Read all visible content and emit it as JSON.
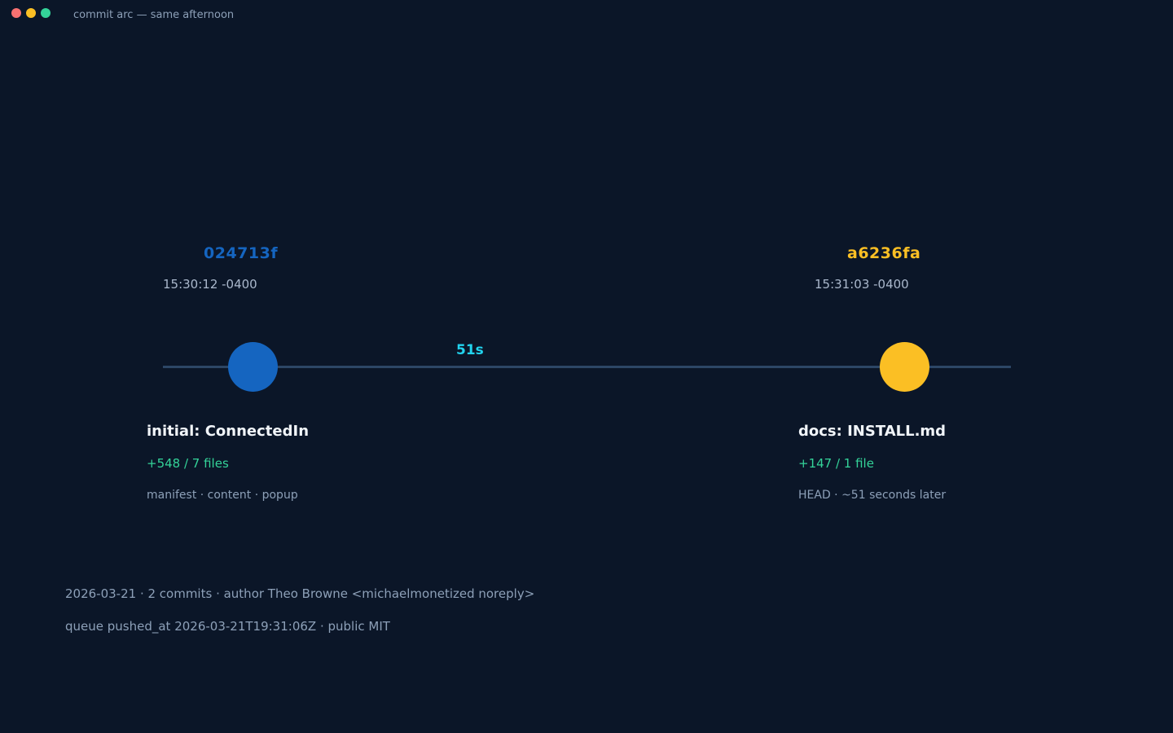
{
  "window": {
    "title": "commit arc — same afternoon",
    "controls": {
      "close_color": "#f87171",
      "minimize_color": "#fbbf24",
      "zoom_color": "#34d399"
    }
  },
  "colors": {
    "background": "#0b1628",
    "first_commit": "#1565c0",
    "second_commit": "#fbbf24",
    "delta": "#22d3ee",
    "additions": "#34d399",
    "timeline": "#2c4666"
  },
  "commits": [
    {
      "hash": "024713f",
      "time": "15:30:12 -0400",
      "message": "initial: ConnectedIn",
      "stats": "+548 / 7 files",
      "detail": "manifest · content · popup"
    },
    {
      "hash": "a6236fa",
      "time": "15:31:03 -0400",
      "message": "docs: INSTALL.md",
      "stats": "+147 / 1 file",
      "detail": "HEAD · ~51 seconds later"
    }
  ],
  "timeline": {
    "delta_label": "51s"
  },
  "footer": {
    "line1": "2026-03-21 · 2 commits · author Theo Browne <michaelmonetized noreply>",
    "line2": "queue pushed_at 2026-03-21T19:31:06Z · public MIT"
  }
}
